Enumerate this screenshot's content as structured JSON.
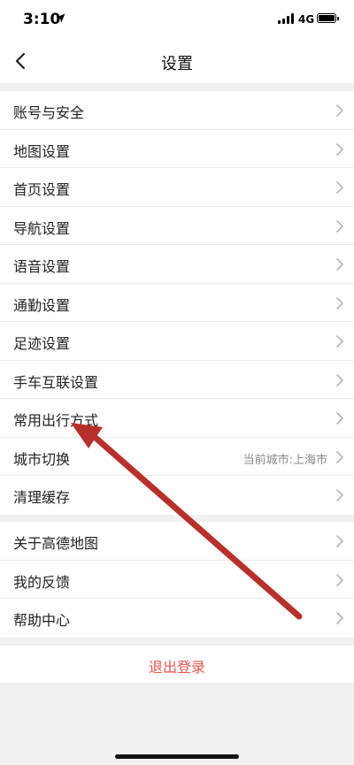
{
  "status_bar": {
    "time": "3:10",
    "network": "4G",
    "icons": [
      "location-arrow-icon",
      "signal-icon",
      "battery-icon"
    ]
  },
  "nav": {
    "title": "设置",
    "back_icon": "chevron-left-icon"
  },
  "group1": [
    {
      "label": "账号与安全"
    },
    {
      "label": "地图设置"
    },
    {
      "label": "首页设置"
    },
    {
      "label": "导航设置"
    },
    {
      "label": "语音设置"
    },
    {
      "label": "通勤设置"
    },
    {
      "label": "足迹设置"
    },
    {
      "label": "手车互联设置"
    },
    {
      "label": "常用出行方式"
    },
    {
      "label": "城市切换",
      "value": "当前城市:上海市"
    },
    {
      "label": "清理缓存"
    }
  ],
  "group2": [
    {
      "label": "关于高德地图"
    },
    {
      "label": "我的反馈"
    },
    {
      "label": "帮助中心"
    }
  ],
  "logout": {
    "label": "退出登录"
  },
  "colors": {
    "background": "#f0f0f0",
    "logout_text": "#e8544e",
    "annotation_arrow": "#b8302a"
  },
  "annotation": {
    "icon": "red-arrow-pointer",
    "target": "常用出行方式"
  }
}
